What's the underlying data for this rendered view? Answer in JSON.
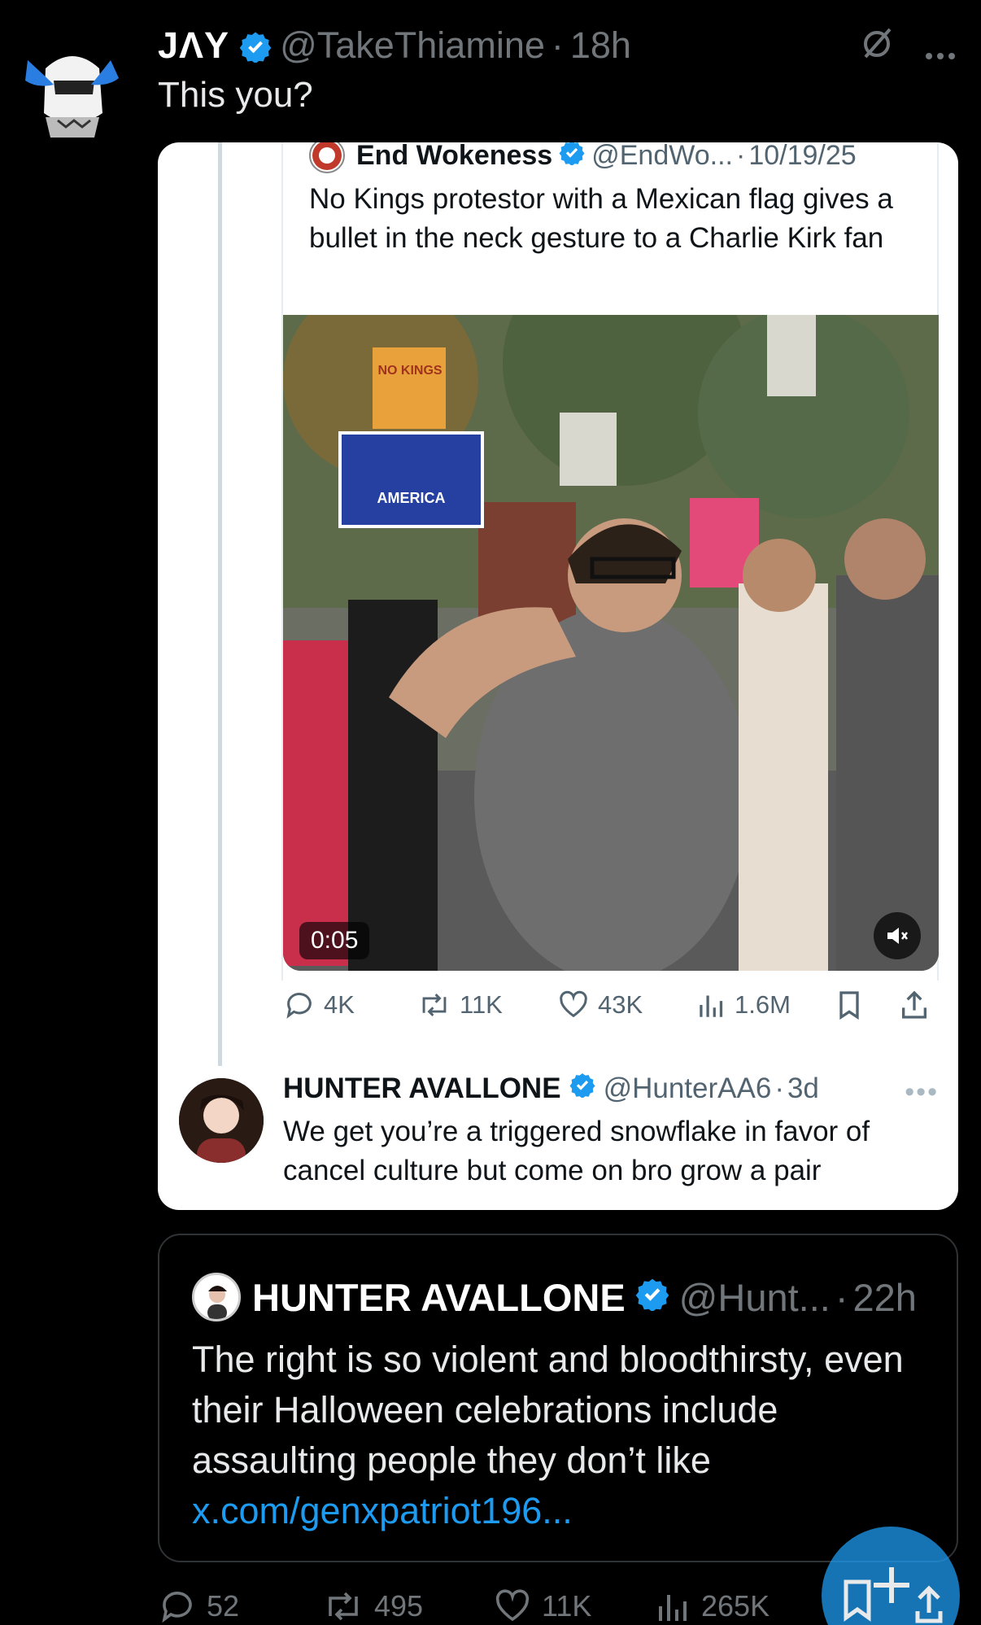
{
  "tweet": {
    "author_name": "JΛY",
    "handle": "@TakeThiamine",
    "separator": "·",
    "time": "18h",
    "text": "This you?"
  },
  "screenshot": {
    "quoted_post": {
      "author_name": "End Wokeness",
      "handle": "@EndWo...",
      "separator": "·",
      "date": "10/19/25",
      "text": "No Kings protestor with a Mexican flag gives a bullet in the neck gesture to a Charlie Kirk fan",
      "video_time": "0:05",
      "sign_text_1": "NO KINGS",
      "sign_text_2": "AMERICA",
      "actions": {
        "replies": "4K",
        "reposts": "11K",
        "likes": "43K",
        "views": "1.6M"
      }
    },
    "reply": {
      "author_name": "HUNTER AVALLONE",
      "handle": "@HunterAA6",
      "separator": "·",
      "time": "3d",
      "text": "We get you’re a triggered snowflake in favor of cancel culture but come on bro grow a pair"
    }
  },
  "quote_tweet": {
    "author_name": "HUNTER AVALLONE",
    "handle": "@Hunt...",
    "separator": "·",
    "time": "22h",
    "text": "The right is so violent and bloodthirsty, even their Halloween celebrations include assaulting people they don’t like ",
    "link": "x.com/genxpatriot196..."
  },
  "actions": {
    "replies": "52",
    "reposts": "495",
    "likes": "11K",
    "views": "265K"
  },
  "colors": {
    "accent": "#1d9bf0",
    "background": "#000000",
    "card": "#ffffff"
  }
}
